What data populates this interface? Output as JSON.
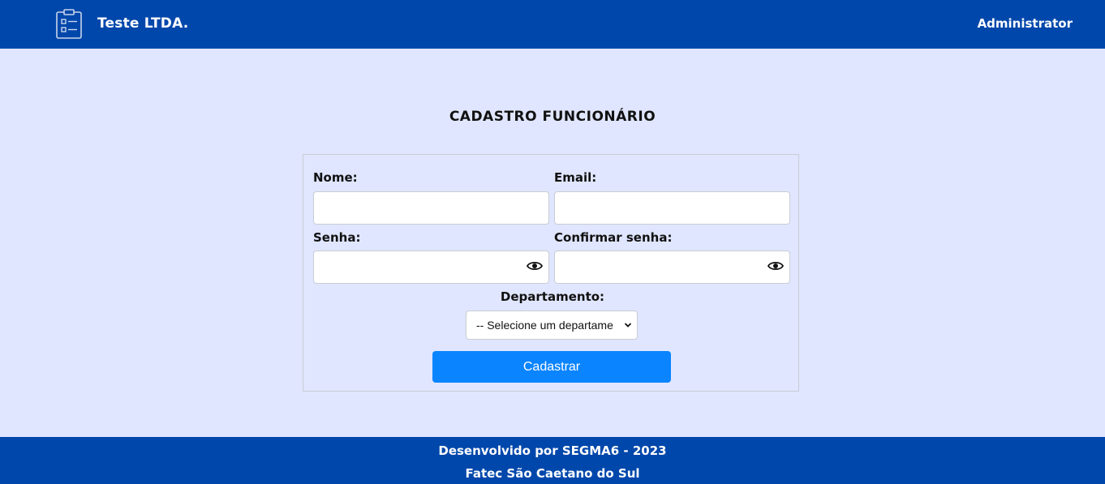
{
  "header": {
    "brand_icon": "clipboard-list-icon",
    "brand_title": "Teste LTDA.",
    "user_name": "Administrator",
    "background_color": "#0047ab"
  },
  "page": {
    "title": "CADASTRO FUNCIONÁRIO",
    "background_color": "#e0e6ff"
  },
  "form": {
    "nome_label": "Nome:",
    "nome_value": "",
    "email_label": "Email:",
    "email_value": "",
    "senha_label": "Senha:",
    "senha_value": "",
    "senha_toggle_icon": "eye-icon",
    "confirmar_label": "Confirmar senha:",
    "confirmar_value": "",
    "confirmar_toggle_icon": "eye-icon",
    "departamento_label": "Departamento:",
    "departamento_selected": "-- Selecione um departame",
    "submit_label": "Cadastrar",
    "submit_color": "#0a84ff"
  },
  "footer": {
    "line1": "Desenvolvido por SEGMA6 - 2023",
    "line2": "Fatec São Caetano do Sul"
  }
}
